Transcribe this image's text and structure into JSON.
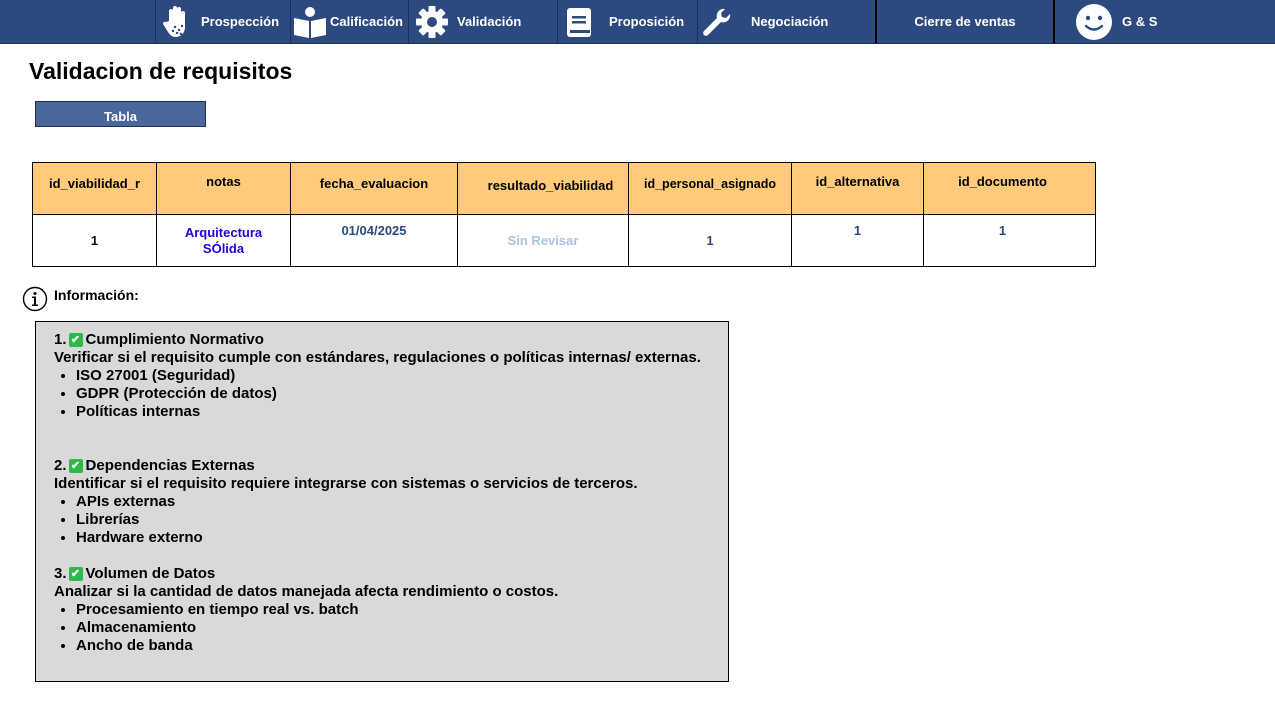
{
  "nav": {
    "items": [
      {
        "label": "Prospección",
        "icon": "hand-icon"
      },
      {
        "label": "Calificación",
        "icon": "reader-icon"
      },
      {
        "label": "Validación",
        "icon": "gear-icon"
      },
      {
        "label": "Proposición",
        "icon": "book-icon"
      },
      {
        "label": "Negociación",
        "icon": "wrench-icon"
      },
      {
        "label": "Cierre de ventas",
        "icon": ""
      }
    ],
    "user": {
      "label": "G & S",
      "icon": "smiley-icon"
    }
  },
  "page": {
    "title": "Validacion de requisitos"
  },
  "tabla_button": {
    "label": "Tabla"
  },
  "table": {
    "columns": [
      "id_viabilidad_r",
      "notas",
      "fecha_evaluacion",
      "resultado_viabilidad",
      "id_personal_asignado",
      "id_alternativa",
      "id_documento"
    ],
    "rows": [
      {
        "id_viabilidad_r": "1",
        "notas_line1": "Arquitectura",
        "notas_line2": "SÓlida",
        "fecha_evaluacion": "01/04/2025",
        "resultado_viabilidad": "Sin Revisar",
        "id_personal_asignado": "1",
        "id_alternativa": "1",
        "id_documento": "1"
      }
    ],
    "colors": {
      "header_bg": "#ffca7a",
      "notas": "#2200dd",
      "value": "#2c4a80",
      "muted": "#a9c4e4"
    }
  },
  "info": {
    "label": "Información:",
    "sections": [
      {
        "number": "1.",
        "check": "✔",
        "title": "Cumplimiento Normativo",
        "description": "Verificar si el requisito cumple con estándares, regulaciones o políticas internas/ externas.",
        "items": [
          "ISO 27001 (Seguridad)",
          "GDPR (Protección de datos)",
          "Políticas internas"
        ]
      },
      {
        "number": "2.",
        "check": "✔",
        "title": "Dependencias Externas",
        "description": "Identificar si el requisito requiere integrarse con sistemas o servicios de terceros.",
        "items": [
          "APIs externas",
          "Librerías",
          "Hardware externo"
        ]
      },
      {
        "number": "3.",
        "check": "✔",
        "title": "Volumen de Datos",
        "description": "Analizar si la cantidad de datos manejada afecta rendimiento o costos.",
        "items": [
          "Procesamiento en tiempo real vs. batch",
          "Almacenamiento",
          "Ancho de banda"
        ]
      }
    ]
  }
}
